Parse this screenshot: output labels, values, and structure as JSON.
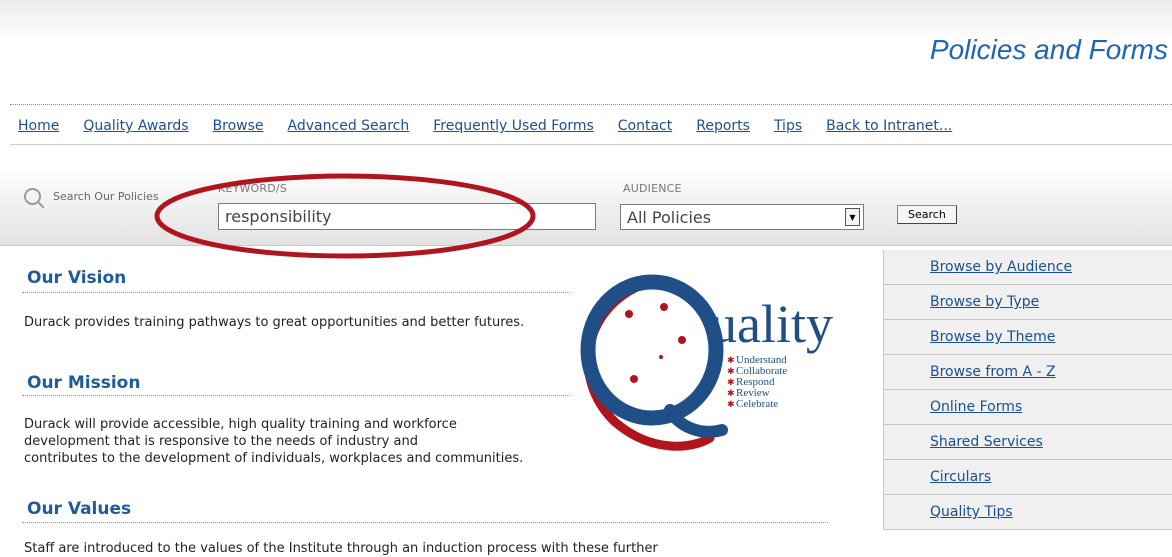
{
  "header": {
    "title": "Policies and Forms"
  },
  "nav": {
    "items": [
      {
        "label": "Home"
      },
      {
        "label": "Quality Awards"
      },
      {
        "label": "Browse"
      },
      {
        "label": "Advanced Search"
      },
      {
        "label": "Frequently Used Forms"
      },
      {
        "label": "Contact"
      },
      {
        "label": "Reports"
      },
      {
        "label": "Tips"
      },
      {
        "label": "Back to Intranet..."
      }
    ]
  },
  "search": {
    "label": "Search Our Policies",
    "keyword_label": "KEYWORD/S",
    "keyword_value": "responsibility",
    "audience_label": "AUDIENCE",
    "audience_value": "All Policies",
    "button_label": "Search"
  },
  "content": {
    "vision_heading": "Our Vision",
    "vision_text": "Durack provides training pathways to great opportunities and better futures.",
    "mission_heading": "Our Mission",
    "mission_text_1": "Durack will provide accessible, high quality training and workforce",
    "mission_text_2": "development that is responsive to the needs of industry and",
    "mission_text_3": "contributes to the development of individuals, workplaces and communities.",
    "values_heading": "Our Values",
    "values_text": "Staff are introduced to the values of the Institute through an induction process with these further"
  },
  "logo": {
    "word": "uality",
    "lines": [
      "Understand",
      "Collaborate",
      "Respond",
      "Review",
      "Celebrate"
    ]
  },
  "sidebar": {
    "items": [
      {
        "label": "Browse by Audience"
      },
      {
        "label": "Browse by Type"
      },
      {
        "label": "Browse by Theme"
      },
      {
        "label": "Browse from A - Z"
      },
      {
        "label": "Online Forms"
      },
      {
        "label": "Shared Services"
      },
      {
        "label": "Circulars"
      },
      {
        "label": "Quality Tips"
      }
    ]
  },
  "colors": {
    "link": "#1a4f93",
    "title": "#1f64b7",
    "heading": "#1f5c97",
    "annotation": "#b0141c",
    "logo_blue": "#1f4f86",
    "logo_red": "#b0141c"
  }
}
